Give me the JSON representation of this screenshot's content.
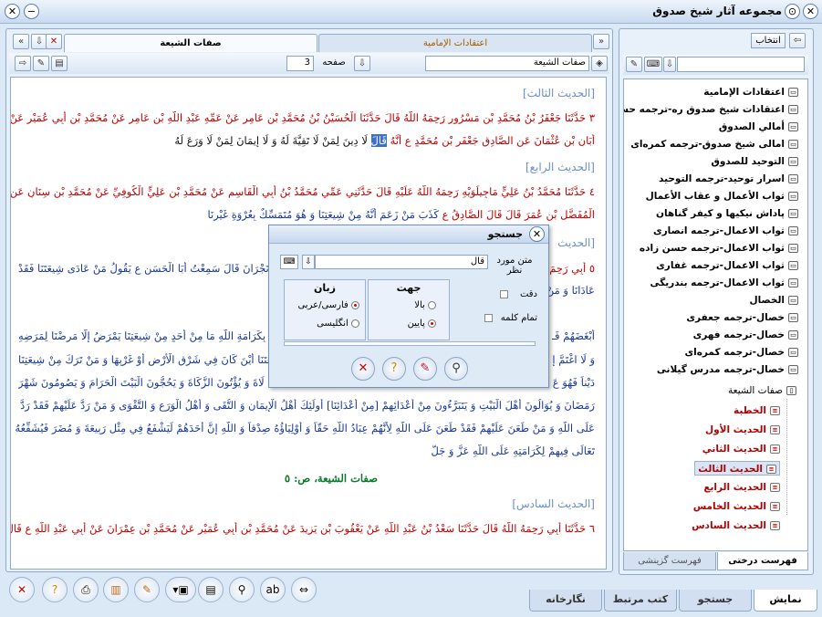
{
  "window": {
    "title": "مجموعه آثار شیخ صدوق"
  },
  "doc_tabs": {
    "active": "صفات الشیعة",
    "inactive": "اعتقادات الإمامية"
  },
  "toolbar": {
    "book_field": "صفات الشیعة",
    "page_label": "صفحه",
    "page_value": "3"
  },
  "reader": {
    "h3": "[الحديث الثالث]",
    "p3a": "٣ حَدَّثَنَا جَعْفَرُ بْنُ مُحَمَّدِ بْنِ مَسْرُورٍ رَحِمَهُ اللَّهُ قَالَ حَدَّثَنَا الْحُسَيْنُ بْنُ مُحَمَّدِ بْنِ عَامِرٍ عَنْ عَمِّهِ عَبْدِ اللَّهِ بْنِ عَامِرٍ عَنْ مُحَمَّدِ بْنِ أَبِي عُمَيْرٍ عَنْ",
    "p3b1": "أَبَانِ بْنِ عُثْمَانَ عَنِ الصَّادِقِ جَعْفَرِ بْنِ مُحَمَّدٍ ع أَنَّهُ",
    "p3b_hl": "قَالَ",
    "p3b2": "لَا دِينَ لِمَنْ لَا تَقِيَّةَ لَهُ وَ لَا إِيمَانَ لِمَنْ لَا وَرَعَ لَهُ",
    "h4": "[الحديث الرابع]",
    "p4a": "٤ حَدَّثَنَا مُحَمَّدُ بْنُ عَلِيٍّ مَاجِيلَوَيْهِ رَحِمَهُ اللَّهُ عَلَيْهِ قَالَ حَدَّثَنِي عَمِّي مُحَمَّدُ بْنُ أَبِي الْقَاسِمِ عَنْ مُحَمَّدِ بْنِ عَلِيٍّ الْكُوفِيِّ عَنْ مُحَمَّدِ بْنِ سِنَانٍ عَنِ",
    "p4b1": "الْمُفَضَّلِ بْنِ عُمَرَ قَالَ قَالَ الصَّادِقُ ع",
    "p4b2": "كَذَبَ مَنْ زَعَمَ أَنَّهُ مِنْ شِيعَتِنَا وَ هُوَ مُتَمَسِّكٌ بِعُرْوَةِ غَيْرِنَا",
    "h5": "[الحديث",
    "p5a_r": "٥ أَبِي رَحِمَ",
    "p5a_l": "نَجْرَانَ قَالَ سَمِعْتُ أَبَا الْحَسَنِ ع يَقُولُ مَنْ عَادَى شِيعَتَنَا فَقَدْ",
    "p5b_r": "عَادَانَا وَ مَنْ",
    "l6_r": "أَبْغَضَهُمْ فَـ",
    "l6_l": "بِكَرَامَةِ اللَّهِ مَا مِنْ أَحَدٍ مِنْ شِيعَتِنَا يَمْرَضُ إِلَّا مَرِضْنَا لِمَرَضِهِ",
    "l7_r": "وَ لَا اغْتَمَّ إِ",
    "l7_l": "مْ شِيعَتَنَا أَيْنَ كَانَ فِي شَرْقِ الْأَرْضِ أَوْ غَرْبِهَا وَ مَنْ تَرَكَ مِنْ شِيعَتِنَا",
    "l8_r": "دَيْناً فَهُوَ عَ",
    "l8_l": "لَاةَ وَ يُؤْتُونَ الزَّكَاةَ وَ يَحُجُّونَ الْبَيْتَ الْحَرَامَ وَ يَصُومُونَ شَهْرَ",
    "l9": "رَمَضَانَ وَ يُوَالُونَ أَهْلَ الْبَيْتِ وَ يَتَبَرَّءُونَ مِنْ أَعْدَائِهِمْ [مِنْ أَعْدَائِنَا] أُولَئِكَ أَهْلُ الْإِيمَانِ وَ التُّقَى وَ أَهْلُ الْوَرَعِ وَ التَّقْوَى وَ مَنْ رَدَّ عَلَيْهِمْ فَقَدْ رَدَّ",
    "l10": "عَلَى اللَّهِ وَ مَنْ طَعَنَ عَلَيْهِمْ فَقَدْ طَعَنَ عَلَى اللَّهِ لِأَنَّهُمْ عِبَادُ اللَّهِ حَقّاً وَ أَوْلِيَاؤُهُ صِدْقاً وَ اللَّهِ إِنَّ أَحَدَهُمْ لَيَشْفَعُ فِي مِثْلِ رَبِيعَةَ وَ مُضَرَ فَيُشَفِّعُهُ اللَّهُ",
    "l11": "تَعَالَى فِيهِمْ لِكَرَامَتِهِ عَلَى اللَّهِ عَزَّ وَ جَلَّ",
    "page_ref": "صفات الشيعة، ص: ٥",
    "h6": "[الحديث السادس]",
    "p6": "٦ حَدَّثَنَا أَبِي رَحِمَهُ اللَّهُ قَالَ حَدَّثَنَا سَعْدُ بْنُ عَبْدِ اللَّهِ عَنْ يَعْقُوبَ بْنِ يَزِيدَ عَنْ مُحَمَّدِ بْنِ أَبِي عُمَيْرٍ عَنْ مُحَمَّدِ بْنِ عِمْرَانَ عَنْ أَبِي عَبْدِ اللَّهِ ع قَالَ"
  },
  "search_dialog": {
    "title": "جستجو",
    "query_label": "متن مورد نظر",
    "query_value": "قال",
    "direction": {
      "title": "جهت",
      "up": "بالا",
      "down": "پایین"
    },
    "language": {
      "title": "زبان",
      "arabic": "فارسی/عربی",
      "english": "انگلیسی"
    },
    "exact_label": "دقت",
    "whole_word_label": "تمام کلمه"
  },
  "right_panel": {
    "select_button": "انتخاب"
  },
  "tree": {
    "items": [
      "اعتقادات الإمامية",
      "اعتقادات شيخ صدوق ره-ترجمه حسنى",
      "أمالي الصدوق",
      "امالى شيخ صدوق-ترجمه کمره‌ای",
      "التوحيد للصدوق",
      "اسرار توحيد-ترجمه التوحيد",
      "ثواب الأعمال و عقاب الأعمال",
      "پاداش نيکيها و کيفر گناهان",
      "ثواب الاعمال-ترجمه انصارى",
      "ثواب الاعمال-ترجمه حسن زاده",
      "ثواب الاعمال-ترجمه غفارى",
      "ثواب الاعمال-ترجمه بندريگى",
      "الخصال",
      "خصال-ترجمه جعفرى",
      "خصال-ترجمه فهرى",
      "خصال-ترجمه کمره‌ای",
      "خصال-ترجمه مدرس گيلانى",
      "صفات الشيعة"
    ],
    "children": [
      "الخطبة",
      "الحديث الأول",
      "الحديث الثاني",
      "الحديث الثالث",
      "الحديث الرابع",
      "الحديث الخامس",
      "الحديث السادس"
    ]
  },
  "tree_tabs": {
    "tree": "فهرست درختى",
    "index": "فهرست گزينشى"
  },
  "bottom_tabs": {
    "display": "نمايش",
    "search": "جستجو",
    "related": "کتب مرتبط",
    "gallery": "نگارخانه"
  }
}
